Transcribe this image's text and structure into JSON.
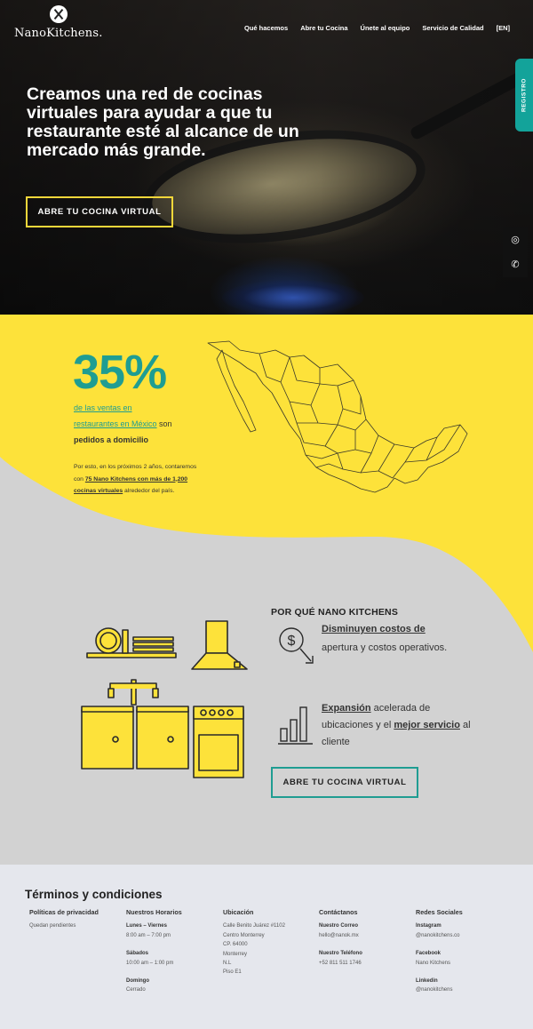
{
  "header": {
    "logo_text": "NanoKitchens.",
    "nav": [
      "Qué hacemos",
      "Únete al equipo",
      "Servicio de Calidad",
      "[EN]"
    ],
    "nav_extra": "Abre tu Cocina",
    "registro": "REGISTRO"
  },
  "hero": {
    "title": "Creamos una red de cocinas virtuales para ayudar a que tu restaurante esté al alcance de un mercado más grande.",
    "cta": "ABRE TU COCINA VIRTUAL"
  },
  "stats": {
    "number": "35%",
    "line1": "de las ventas en",
    "line2": "restaurantes en México",
    "line2b": " son",
    "line3": "pedidos a domicilio",
    "small1": "Por esto, en los próximos 2 años, contaremos con ",
    "small_bold": "75 Nano Kitchens con más de 1,200 cocinas virtuales",
    "small2": " alrededor del país."
  },
  "why": {
    "title": "POR QUÉ NANO KITCHENS",
    "b1_bold": "Disminuyen costos de",
    "b1_rest": "apertura y costos operativos.",
    "b2_bold1": "Expansión",
    "b2_mid": " acelerada de ubicaciones y el ",
    "b2_bold2": "mejor servicio",
    "b2_end": " al cliente",
    "cta": "ABRE TU COCINA VIRTUAL",
    "dollar": "$"
  },
  "footer": {
    "title": "Términos y condiciones",
    "col1": {
      "heading": "Políticas de privacidad",
      "text": "Quedan pendientes"
    },
    "col2": {
      "heading": "Nuestros Horarios",
      "l1": "Lunes – Viernes",
      "v1": "8:00 am – 7:00 pm",
      "l2": "Sábados",
      "v2": "10:00 am – 1:00 pm",
      "l3": "Domingo",
      "v3": "Cerrado"
    },
    "col3": {
      "heading": "Ubicación",
      "lines": [
        "Calle Benito Juárez #1102",
        "Centro Monterrey",
        "CP. 64000",
        "Monterrey",
        "N.L",
        "Piso E1"
      ]
    },
    "col4": {
      "heading": "Contáctanos",
      "l1": "Nuestro Correo",
      "v1": "hello@nanok.mx",
      "l2": "Nuestro Teléfono",
      "v2": "+52 811 511 1746"
    },
    "col5": {
      "heading": "Redes Sociales",
      "l1": "Instagram",
      "v1": "@nanokitchens.co",
      "l2": "Facebook",
      "v2": "Nano Kitchens",
      "l3": "Linkedin",
      "v3": "@nanokitchens"
    }
  },
  "colors": {
    "yellow": "#fde23a",
    "teal": "#1f9d92",
    "gray": "#d2d2d2",
    "footer": "#e5e7ed"
  }
}
